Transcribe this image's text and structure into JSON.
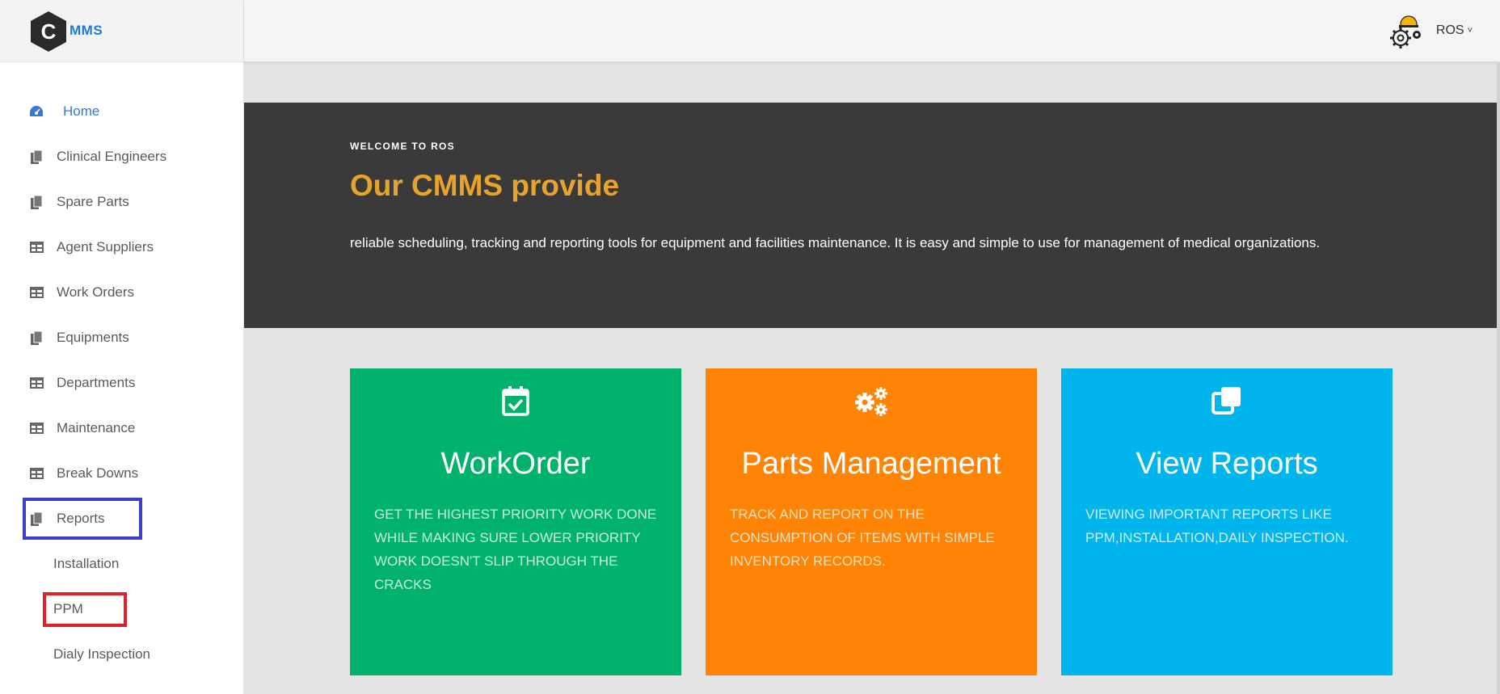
{
  "brand": {
    "logo_letter": "C",
    "logo_text": "MMS"
  },
  "header": {
    "user_name": "ROS",
    "caret": "˅"
  },
  "sidebar": {
    "items": [
      {
        "label": "Home",
        "icon": "dashboard-icon"
      },
      {
        "label": "Clinical Engineers",
        "icon": "copy-icon"
      },
      {
        "label": "Spare Parts",
        "icon": "copy-icon"
      },
      {
        "label": "Agent Suppliers",
        "icon": "table-icon"
      },
      {
        "label": "Work Orders",
        "icon": "table-icon"
      },
      {
        "label": "Equipments",
        "icon": "copy-icon"
      },
      {
        "label": "Departments",
        "icon": "table-icon"
      },
      {
        "label": "Maintenance",
        "icon": "table-icon"
      },
      {
        "label": "Break Downs",
        "icon": "table-icon"
      },
      {
        "label": "Reports",
        "icon": "copy-icon"
      }
    ],
    "sub_items": [
      {
        "label": "Installation"
      },
      {
        "label": "PPM"
      },
      {
        "label": "Dialy Inspection"
      }
    ]
  },
  "hero": {
    "kicker": "WELCOME TO ROS",
    "title": "Our CMMS provide",
    "description": "reliable scheduling, tracking and reporting tools for equipment and facilities maintenance. It is easy and simple to use for management of medical organizations."
  },
  "cards": [
    {
      "title": "WorkOrder",
      "description": "GET THE HIGHEST PRIORITY WORK DONE WHILE MAKING SURE LOWER PRIORITY WORK DOESN'T SLIP THROUGH THE CRACKS",
      "icon": "calendar-check-icon",
      "color": "#00b26b"
    },
    {
      "title": "Parts Management",
      "description": "TRACK AND REPORT ON THE CONSUMPTION OF ITEMS WITH SIMPLE INVENTORY RECORDS.",
      "icon": "gears-icon",
      "color": "#ff8405"
    },
    {
      "title": "View Reports",
      "description": "VIEWING IMPORTANT REPORTS LIKE PPM,INSTALLATION,DAILY INSPECTION.",
      "icon": "clone-icon",
      "color": "#00b5ec"
    }
  ],
  "colors": {
    "accent": "#3a78d6",
    "hero_bg": "#3a3a3a",
    "hero_title": "#e8a42a",
    "highlight_blue": "#3d3fc8",
    "highlight_red": "#e0202a"
  }
}
